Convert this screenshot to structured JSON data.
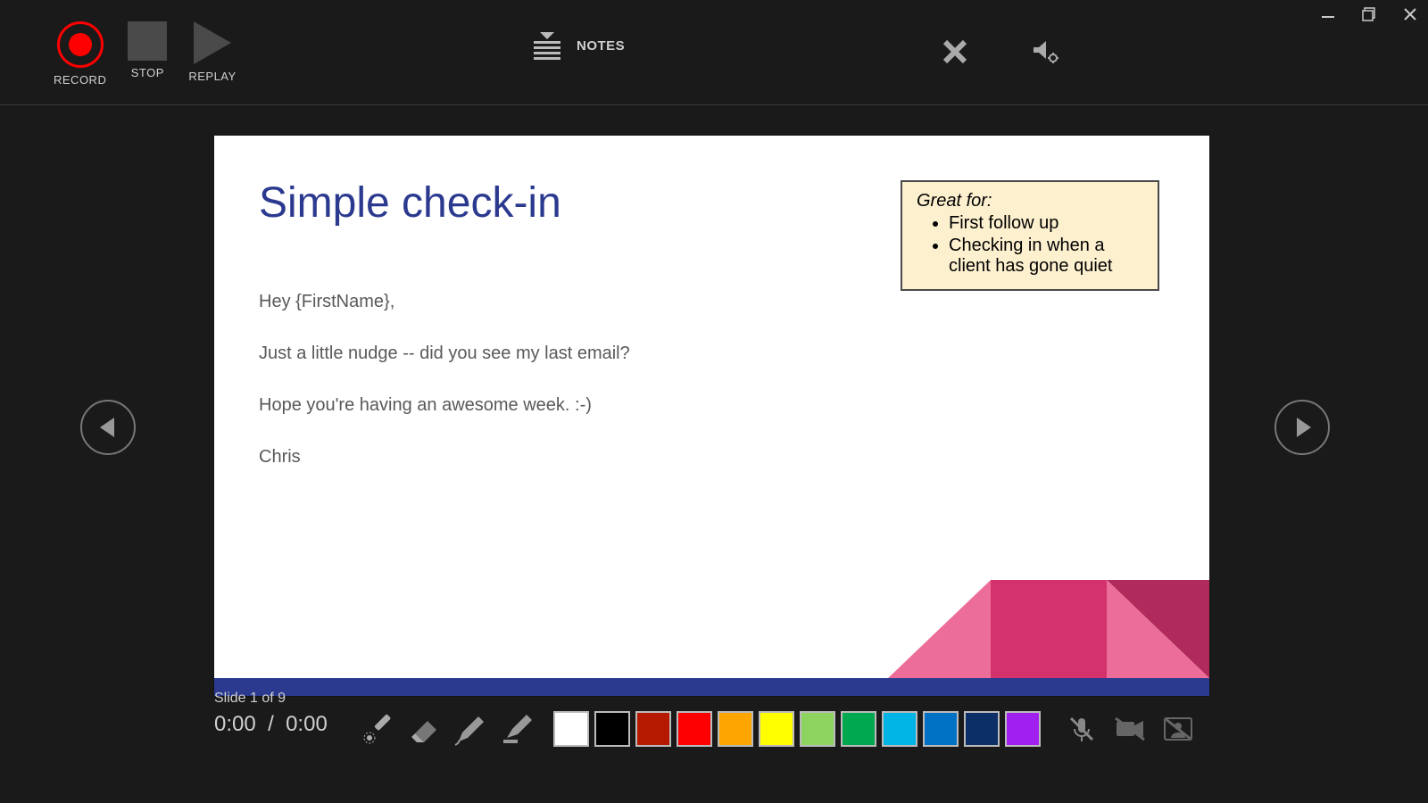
{
  "window": {
    "minimize": "–",
    "maximize": "◻",
    "close": "×"
  },
  "toolbar": {
    "record": "RECORD",
    "stop": "STOP",
    "replay": "REPLAY",
    "notes": "NOTES"
  },
  "slide": {
    "title": "Simple check-in",
    "body": [
      "Hey {FirstName},",
      "Just a little nudge -- did you see my last email?",
      "Hope you're having an awesome week. :-)",
      "Chris"
    ],
    "callout_title": "Great for:",
    "callout_items": [
      "First follow up",
      "Checking in when a client has gone quiet"
    ]
  },
  "footer": {
    "slide_indicator": "Slide 1 of 9",
    "time_elapsed": "0:00",
    "time_sep": "/",
    "time_total": "0:00"
  },
  "swatches": [
    "#ffffff",
    "#000000",
    "#b51a00",
    "#ff0000",
    "#ffa500",
    "#ffff00",
    "#8dd35f",
    "#00a84f",
    "#00b4e6",
    "#0072c6",
    "#0b2f66",
    "#a020f0"
  ]
}
